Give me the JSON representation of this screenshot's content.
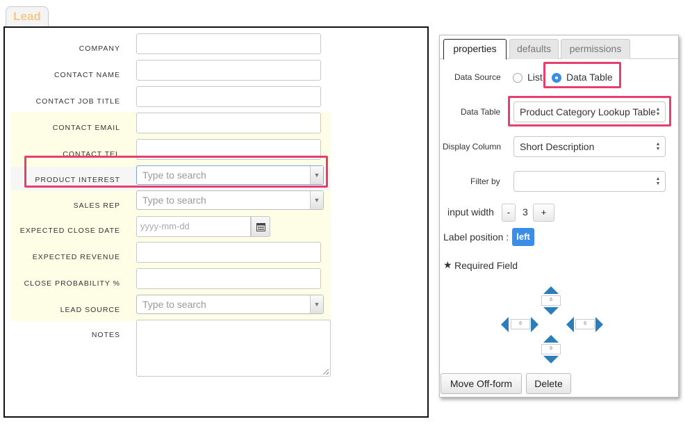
{
  "form": {
    "tab_label": "Lead",
    "fields": {
      "company": "COMPANY",
      "contact_name": "CONTACT NAME",
      "contact_job_title": "CONTACT JOB TITLE",
      "contact_email": "CONTACT EMAIL",
      "contact_tel": "CONTACT TEL",
      "product_interest": "PRODUCT INTEREST",
      "sales_rep": "SALES REP",
      "expected_close_date": "EXPECTED CLOSE DATE",
      "expected_revenue": "EXPECTED REVENUE",
      "close_probability": "CLOSE PROBABILITY %",
      "lead_source": "LEAD SOURCE",
      "notes": "NOTES"
    },
    "placeholders": {
      "search": "Type to search",
      "date": "yyyy-mm-dd"
    }
  },
  "properties": {
    "tabs": [
      "properties",
      "defaults",
      "permissions"
    ],
    "active_tab": "properties",
    "data_source_label": "Data Source",
    "data_source_options": [
      "List",
      "Data Table"
    ],
    "data_source_selected": "Data Table",
    "data_table_label": "Data Table",
    "data_table_value": "Product Category Lookup Table",
    "display_column_label": "Display Column",
    "display_column_value": "Short Description",
    "filter_by_label": "Filter by",
    "filter_by_value": "",
    "input_width_label": "input width",
    "input_width_minus": "-",
    "input_width_value": "3",
    "input_width_plus": "+",
    "label_position_label": "Label position :",
    "label_position_value": "left",
    "required_label": "Required Field",
    "margins": {
      "top": "0",
      "left": "0",
      "right": "0",
      "bottom": "0"
    },
    "move_off_form": "Move Off-form",
    "delete": "Delete"
  },
  "colors": {
    "highlight_callout": "#e83e6f",
    "accent": "#3a8ee8",
    "arrow": "#2a7fba",
    "yellow_bg": "#fefde6",
    "lead_tab_text": "#f3c98b"
  }
}
